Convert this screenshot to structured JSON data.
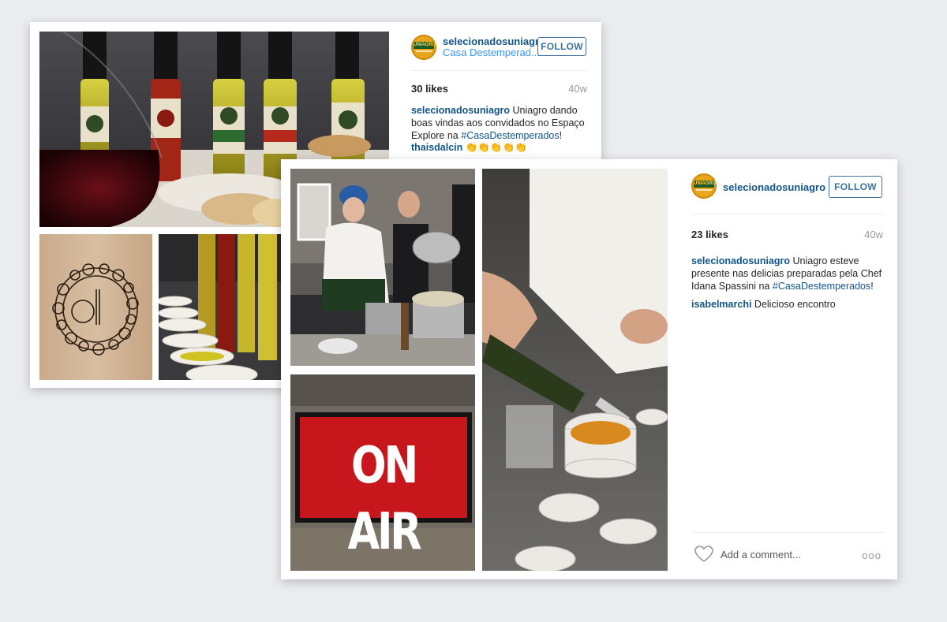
{
  "post1": {
    "username": "selecionadosuniagro",
    "location": "Casa Destemperad...",
    "follow_label": "FOLLOW",
    "likes": "30 likes",
    "age": "40w",
    "caption_user": "selecionadosuniagro",
    "caption_text": "Uniagro dando boas vindas aos convidados no Espaço Explore na",
    "caption_tag": "#CasaDestemperados",
    "caption_end": "!",
    "comment_user": "thaisdalcin",
    "comment_text": "👏👏👏👏👏",
    "avatar_text": "UNIAGRO",
    "sign_text": ""
  },
  "post2": {
    "username": "selecionadosuniagro",
    "follow_label": "FOLLOW",
    "likes": "23 likes",
    "age": "40w",
    "caption_user": "selecionadosuniagro",
    "caption_text": "Uniagro esteve presente nas delicias preparadas pela Chef Idana Spassini na",
    "caption_tag": "#CasaDestemperados",
    "caption_end": "!",
    "comment_user": "isabelmarchi",
    "comment_text": "Delicioso encontro",
    "add_comment": "Add a comment...",
    "more": "ooo",
    "avatar_text": "UNIAGRO",
    "sign_text": "ON AIR"
  },
  "colors": {
    "username": "#125688",
    "follow": "#3f729b",
    "background": "#ebecef",
    "sign_red": "#c8161d"
  },
  "icons": [
    "heart-icon",
    "more-options-icon"
  ]
}
